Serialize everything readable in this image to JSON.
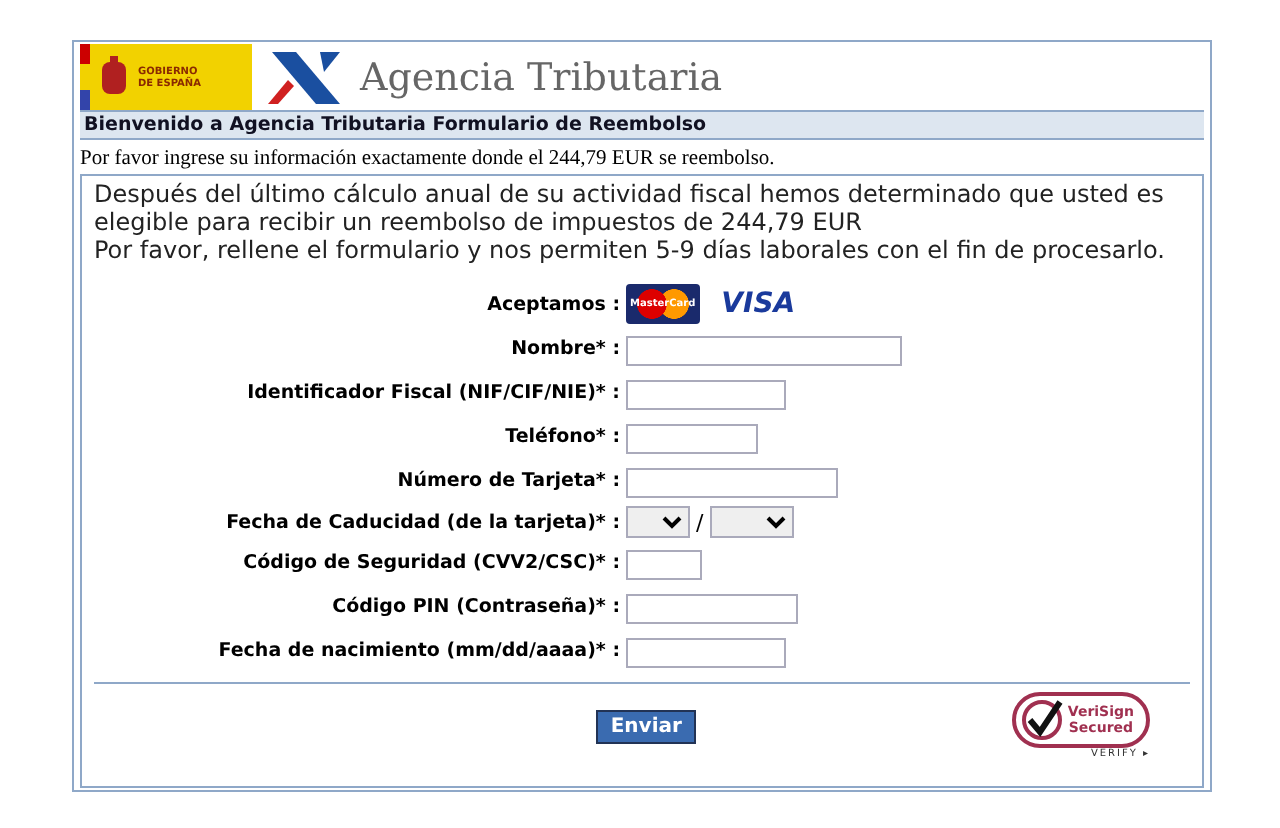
{
  "header": {
    "government_logo": [
      "GOBIERNO",
      "DE ESPAÑA"
    ],
    "agency_name": "Agencia Tributaria"
  },
  "title_bar": "Bienvenido a Agencia Tributaria Formulario de Reembolso",
  "notice": "Por favor ingrese su información exactamente donde el 244,79 EUR se reembolso.",
  "intro": [
    "Después del último cálculo anual de su actividad fiscal hemos determinado que usted es elegible para recibir un reembolso de impuestos de 244,79 EUR",
    "Por favor, rellene el formulario y nos permiten 5-9 días laborales con el fin de procesarlo."
  ],
  "form": {
    "accepted_label": "Aceptamos :",
    "cards": [
      {
        "kind": "mastercard",
        "text": "MasterCard"
      },
      {
        "kind": "visa",
        "text": "VISA"
      }
    ],
    "fields": [
      {
        "kind": "text",
        "label": "Nombre* :"
      },
      {
        "kind": "text",
        "label": "Identificador Fiscal (NIF/CIF/NIE)* :"
      },
      {
        "kind": "text",
        "label": "Teléfono* :"
      },
      {
        "kind": "text",
        "label": "Número de Tarjeta* :"
      },
      {
        "kind": "date",
        "label": "Fecha de Caducidad (de la tarjeta)* :",
        "separator": "/"
      },
      {
        "kind": "text",
        "label": "Código de Seguridad (CVV2/CSC)* :"
      },
      {
        "kind": "text",
        "label": "Código PIN (Contraseña)* :"
      },
      {
        "kind": "text",
        "label": "Fecha de nacimiento (mm/dd/aaaa)* :"
      }
    ],
    "submit": "Enviar"
  },
  "seal": {
    "lines": [
      "VeriSign",
      "Secured"
    ],
    "verify": "VERIFY ▸"
  }
}
